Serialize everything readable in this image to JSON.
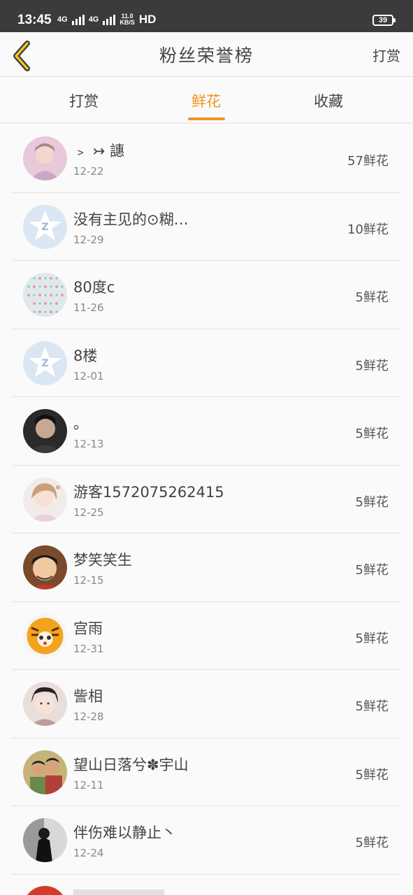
{
  "status_bar": {
    "time": "13:45",
    "net1": "4G",
    "net2": "4G",
    "speed_value": "11.0",
    "speed_unit": "KB/S",
    "hd": "HD",
    "battery": "39"
  },
  "header": {
    "title": "粉丝荣誉榜",
    "right_action": "打赏"
  },
  "tabs": [
    {
      "label": "打赏"
    },
    {
      "label": "鲜花"
    },
    {
      "label": "收藏"
    }
  ],
  "active_tab": 1,
  "accent_color": "#f0961e",
  "entries": [
    {
      "name": "﹥ ↣ 譓",
      "date": "12-22",
      "count": "57鲜花",
      "avatar": "photo-portrait"
    },
    {
      "name": "没有主见的⊙糊…",
      "date": "12-29",
      "count": "10鲜花",
      "avatar": "default-qq-icon"
    },
    {
      "name": "80度c",
      "date": "11-26",
      "count": "5鲜花",
      "avatar": "floral-pattern"
    },
    {
      "name": "8楼",
      "date": "12-01",
      "count": "5鲜花",
      "avatar": "default-qq-icon"
    },
    {
      "name": "。",
      "date": "12-13",
      "count": "5鲜花",
      "avatar": "photo-portrait"
    },
    {
      "name": "游客1572075262415",
      "date": "12-25",
      "count": "5鲜花",
      "avatar": "anime-portrait"
    },
    {
      "name": "梦笑笑生",
      "date": "12-15",
      "count": "5鲜花",
      "avatar": "cartoon-face"
    },
    {
      "name": "宫雨",
      "date": "12-31",
      "count": "5鲜花",
      "avatar": "tiger-cartoon"
    },
    {
      "name": "訾相",
      "date": "12-28",
      "count": "5鲜花",
      "avatar": "anime-portrait"
    },
    {
      "name": "望山日落兮✽宇山",
      "date": "12-11",
      "count": "5鲜花",
      "avatar": "photo-kids"
    },
    {
      "name": "伴伤难以静止丶",
      "date": "12-24",
      "count": "5鲜花",
      "avatar": "photo-bw"
    }
  ]
}
